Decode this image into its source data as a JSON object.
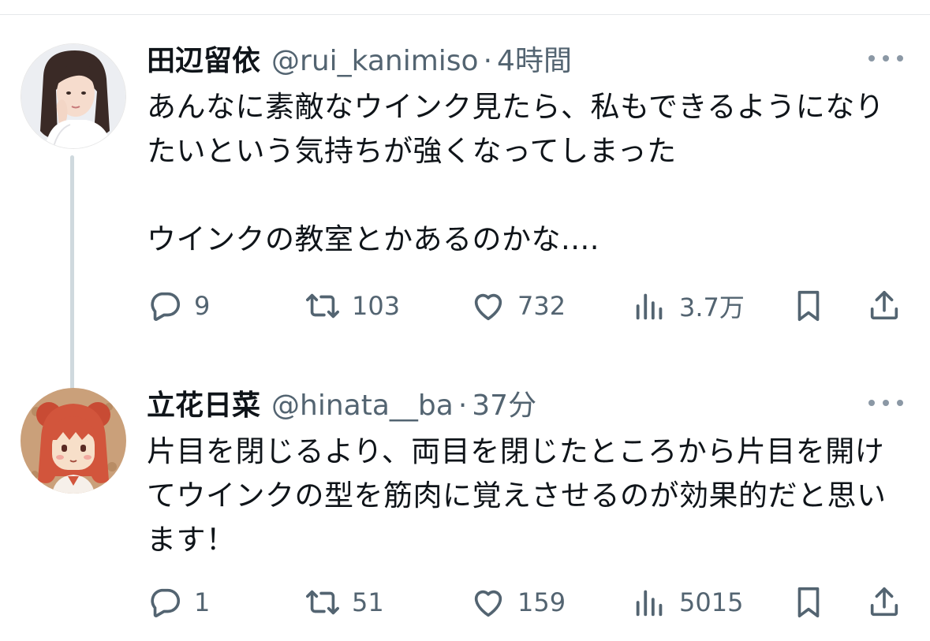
{
  "tweets": [
    {
      "author_name": "田辺留依",
      "handle": "@rui_kanimiso",
      "separator": "·",
      "time": "4時間",
      "text": "あんなに素敵なウインク見たら、私もできるようになりたいという気持ちが強くなってしまった\n\nウインクの教室とかあるのかな....",
      "replies": "9",
      "retweets": "103",
      "likes": "732",
      "views": "3.7万"
    },
    {
      "author_name": "立花日菜",
      "handle": "@hinata__ba",
      "separator": "·",
      "time": "37分",
      "text": "片目を閉じるより、両目を閉じたところから片目を開けてウインクの型を筋肉に覚えさせるのが効果的だと思います！",
      "replies": "1",
      "retweets": "51",
      "likes": "159",
      "views": "5015"
    }
  ],
  "icons": {
    "reply": "reply-icon",
    "retweet": "retweet-icon",
    "like": "heart-icon",
    "views": "views-icon",
    "bookmark": "bookmark-icon",
    "share": "share-icon",
    "more": "more-icon"
  },
  "colors": {
    "text": "#0f1419",
    "secondary": "#536471",
    "thread_line": "#cfd9de",
    "divider": "#e6e8ea"
  }
}
